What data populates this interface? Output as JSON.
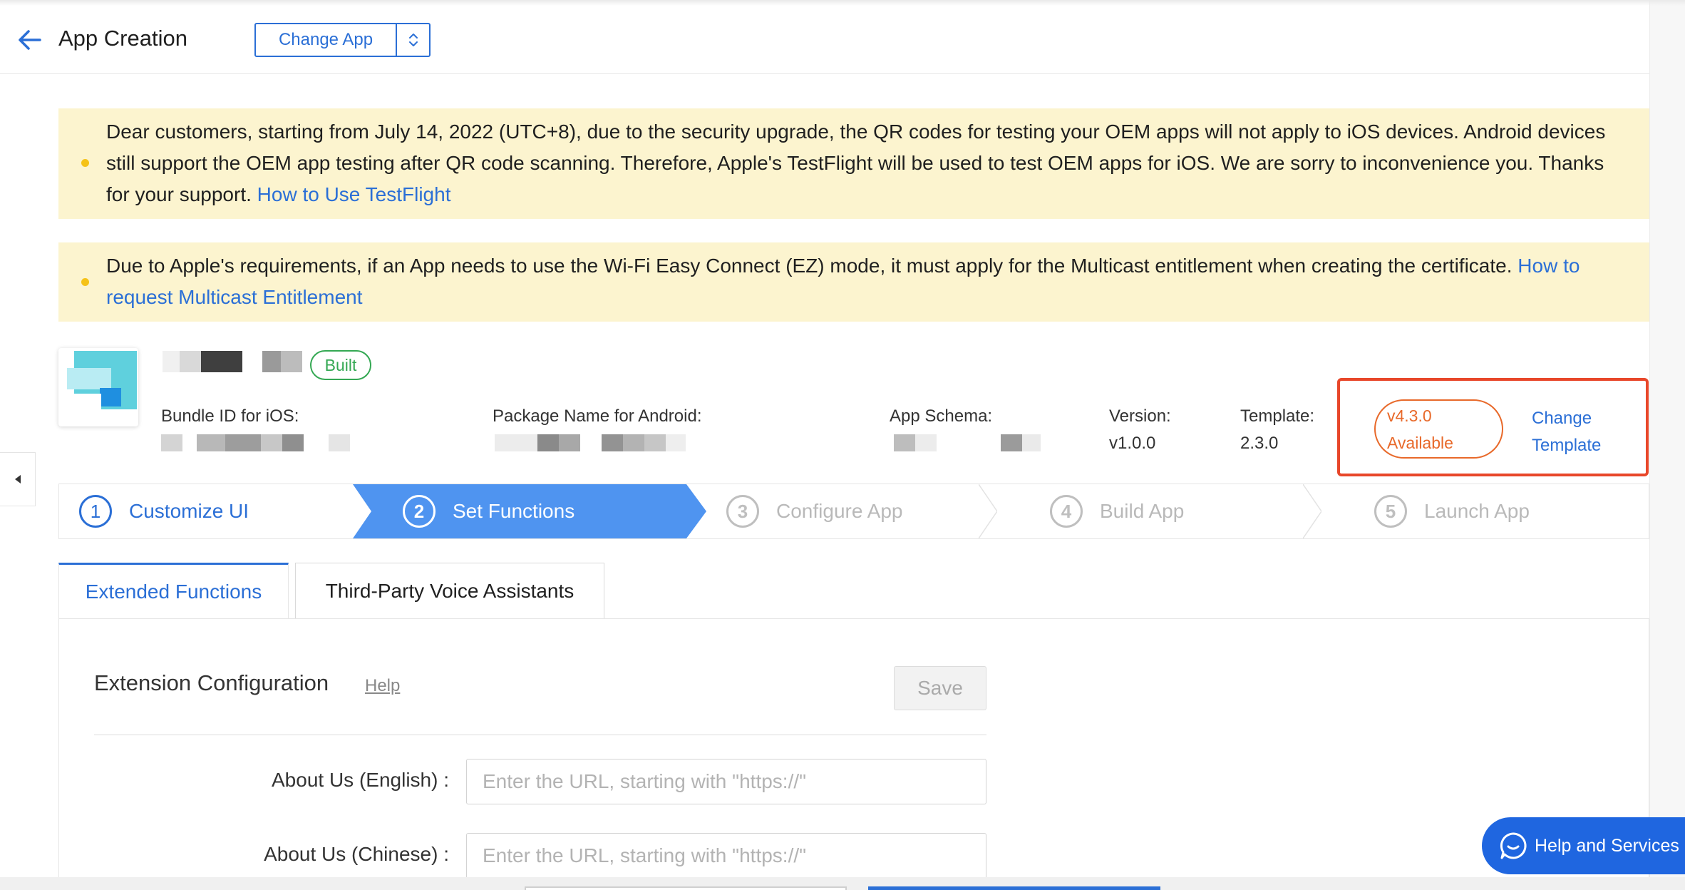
{
  "header": {
    "title": "App Creation",
    "change_app_label": "Change App"
  },
  "notices": {
    "first_text": "Dear customers, starting from July 14, 2022 (UTC+8), due to the security upgrade, the QR codes for testing your OEM apps will not apply to iOS devices. Android devices still support the OEM app testing after QR code scanning. Therefore, Apple's TestFlight will be used to test OEM apps for iOS. We are sorry to inconvenience you. Thanks for your support. ",
    "first_link": "How to Use TestFlight",
    "second_text": "Due to Apple's requirements, if an App needs to use the Wi-Fi Easy Connect (EZ) mode, it must apply for the Multicast entitlement when creating the certificate. ",
    "second_link": "How to request Multicast Entitlement"
  },
  "app_info": {
    "status_badge": "Built",
    "bundle_id_label": "Bundle ID for iOS:",
    "package_name_label": "Package Name for Android:",
    "app_schema_label": "App Schema:",
    "version_label": "Version:",
    "version_value": "v1.0.0",
    "template_label": "Template:",
    "template_value": "2.3.0",
    "available_version": "v4.3.0",
    "available_text": "Available",
    "change_template_line1": "Change",
    "change_template_line2": "Template"
  },
  "steps": [
    {
      "number": "1",
      "label": "Customize UI",
      "state": "done"
    },
    {
      "number": "2",
      "label": "Set Functions",
      "state": "active"
    },
    {
      "number": "3",
      "label": "Configure App",
      "state": "pending"
    },
    {
      "number": "4",
      "label": "Build App",
      "state": "pending"
    },
    {
      "number": "5",
      "label": "Launch App",
      "state": "pending"
    }
  ],
  "tabs": [
    {
      "label": "Extended Functions",
      "selected": true
    },
    {
      "label": "Third-Party Voice Assistants",
      "selected": false
    }
  ],
  "extension": {
    "title": "Extension Configuration",
    "help_label": "Help",
    "save_label": "Save",
    "fields": [
      {
        "label": "About Us (English) :",
        "value": "",
        "placeholder": "Enter the URL, starting with \"https://\""
      },
      {
        "label": "About Us (Chinese) :",
        "value": "",
        "placeholder": "Enter the URL, starting with \"https://\""
      }
    ]
  },
  "help_services_label": "Help and Services",
  "colors": {
    "accent": "#2b6fd6",
    "active_step": "#4f94f0",
    "notice_bg": "#fcf4cf",
    "highlight": "#e8472a",
    "available": "#e8692a",
    "built": "#34a853"
  },
  "icons": [
    "back-arrow-icon",
    "up-down-chevron-icon",
    "collapse-left-icon",
    "bullet-dot-icon",
    "chat-bubble-icon"
  ]
}
